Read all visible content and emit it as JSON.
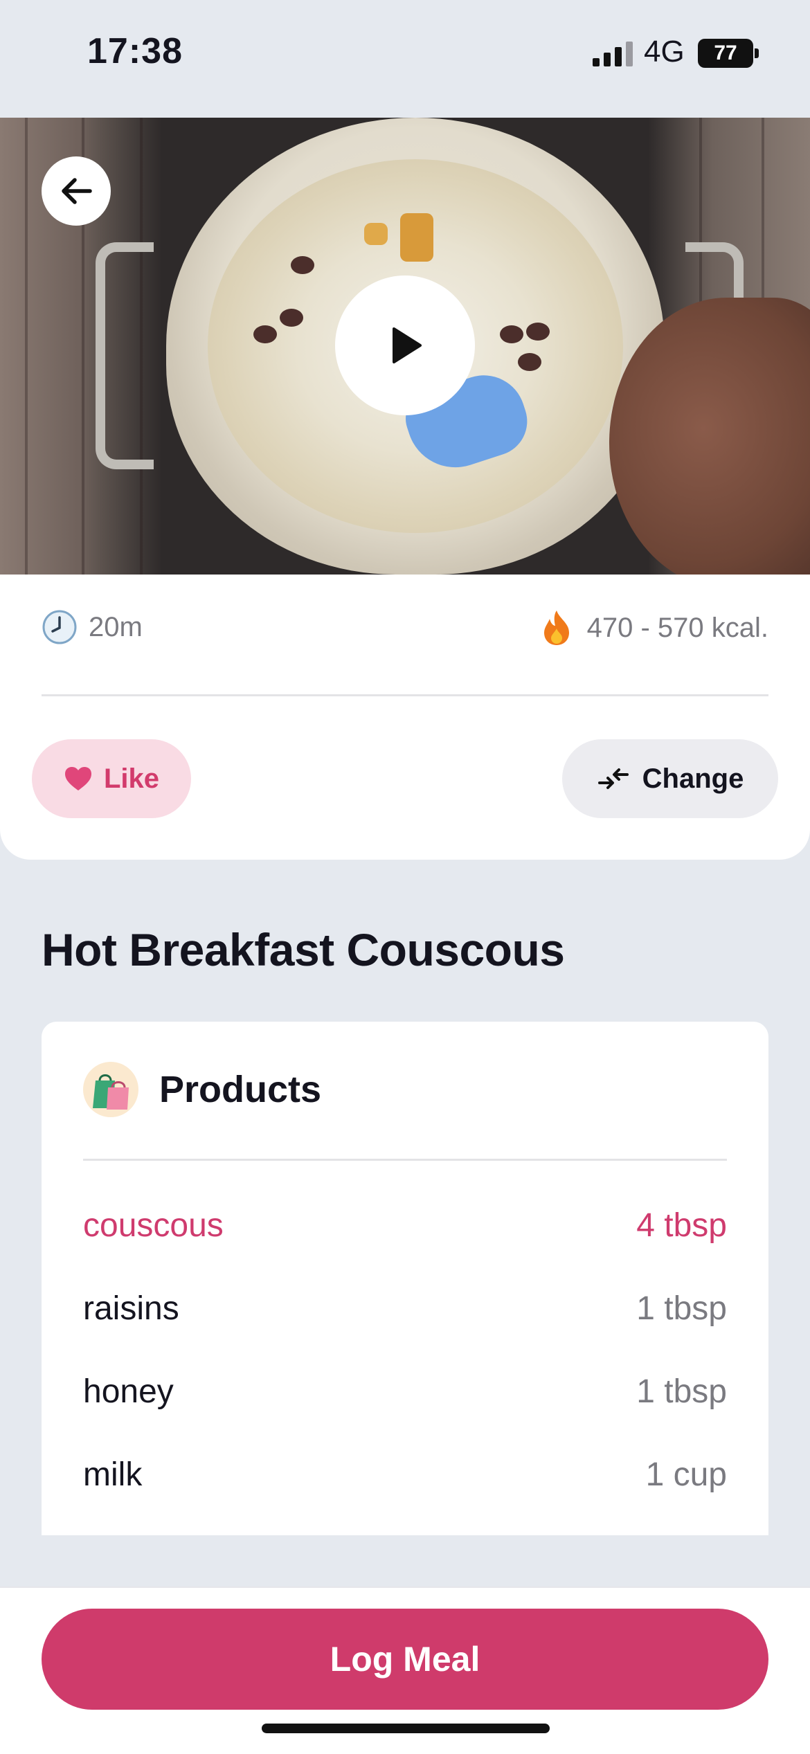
{
  "status_bar": {
    "time": "17:38",
    "network": "4G",
    "battery": "77"
  },
  "hero": {
    "back_icon": "arrow-left-icon",
    "play_icon": "play-icon"
  },
  "meta": {
    "duration": "20m",
    "duration_icon": "clock-icon",
    "calories": "470 - 570 kcal.",
    "calories_icon": "fire-icon"
  },
  "actions": {
    "like_label": "Like",
    "like_icon": "heart-icon",
    "change_label": "Change",
    "change_icon": "swap-arrows-icon"
  },
  "recipe": {
    "title": "Hot Breakfast Couscous"
  },
  "products": {
    "title": "Products",
    "icon": "shopping-bags-icon",
    "items": [
      {
        "name": "couscous",
        "quantity": "4 tbsp"
      },
      {
        "name": "raisins",
        "quantity": "1 tbsp"
      },
      {
        "name": "honey",
        "quantity": "1 tbsp"
      },
      {
        "name": "milk",
        "quantity": "1 cup"
      }
    ]
  },
  "footer": {
    "log_label": "Log Meal"
  },
  "colors": {
    "accent": "#cf3b6b",
    "like_bg": "#f9dbe4",
    "page_bg": "#e5e9ef"
  }
}
